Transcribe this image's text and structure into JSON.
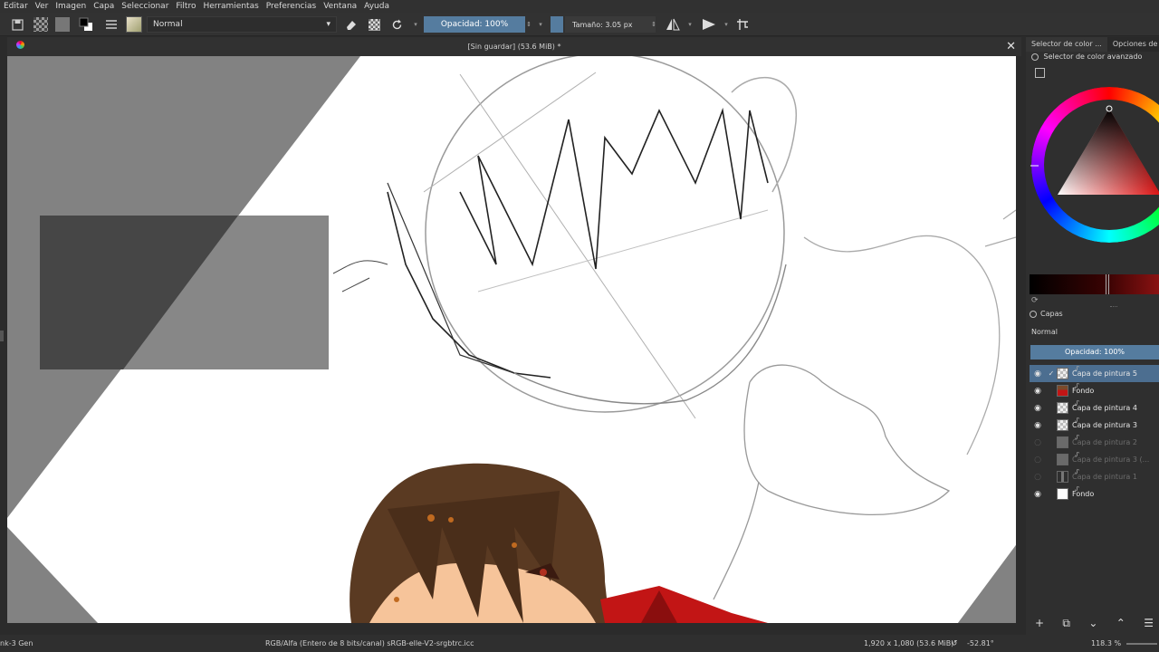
{
  "menu": [
    "Editar",
    "Ver",
    "Imagen",
    "Capa",
    "Seleccionar",
    "Filtro",
    "Herramientas",
    "Preferencias",
    "Ventana",
    "Ayuda"
  ],
  "toolbar": {
    "blend_mode": "Normal",
    "opacity_label": "Opacidad: 100%",
    "size_label": "Tamaño: 3.05 px"
  },
  "document": {
    "title": "[Sin guardar]  (53.6 MiB) *"
  },
  "docker": {
    "tabs": [
      "Selector de color ...",
      "Opciones de"
    ],
    "subtitle": "Selector de color avanzado"
  },
  "layers": {
    "title": "Capas",
    "blend_mode": "Normal",
    "opacity_label": "Opacidad:  100%",
    "items": [
      {
        "name": "Capa de pintura 5",
        "visible": true,
        "active": true,
        "thumb": "checker"
      },
      {
        "name": "Fondo",
        "visible": true,
        "active": false,
        "thumb": "portrait"
      },
      {
        "name": "Capa de pintura 4",
        "visible": true,
        "active": false,
        "thumb": "checker"
      },
      {
        "name": "Capa de pintura 3",
        "visible": true,
        "active": false,
        "thumb": "checker"
      },
      {
        "name": "Capa de pintura 2",
        "visible": false,
        "active": false,
        "thumb": "gray"
      },
      {
        "name": "Capa de pintura 3 (...",
        "visible": false,
        "active": false,
        "thumb": "gray"
      },
      {
        "name": "Capa de pintura 1",
        "visible": false,
        "active": false,
        "thumb": "bar"
      },
      {
        "name": "Fondo",
        "visible": true,
        "active": false,
        "thumb": "white"
      }
    ]
  },
  "status": {
    "brush": "nk-3 Gen",
    "color_profile": "RGB/Alfa (Entero de 8 bits/canal)  sRGB-elle-V2-srgbtrc.icc",
    "dimensions": "1,920 x 1,080 (53.6 MiB)",
    "rotation": "-52.81°",
    "zoom": "118.3 %"
  },
  "colors": {
    "accent": "#557c9f",
    "foreground": "#000000",
    "selected_hue": "#c21515"
  }
}
